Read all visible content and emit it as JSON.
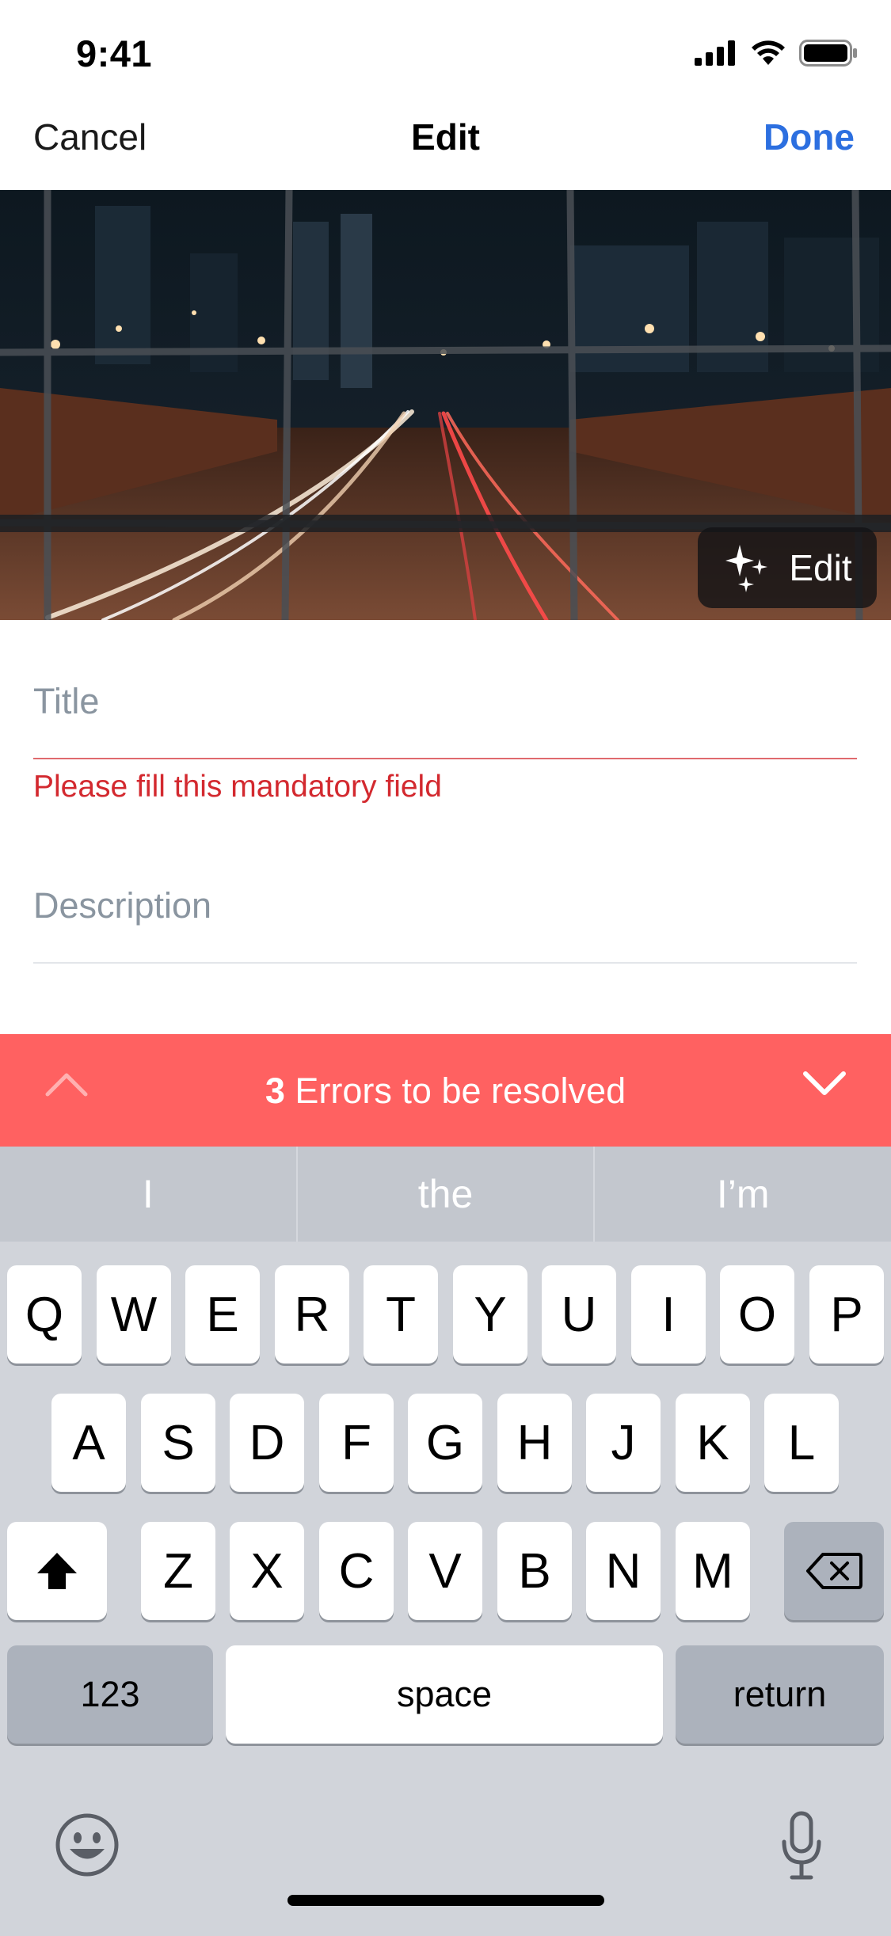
{
  "status": {
    "time": "9:41"
  },
  "nav": {
    "cancel": "Cancel",
    "title": "Edit",
    "done": "Done"
  },
  "photo": {
    "edit_label": "Edit"
  },
  "form": {
    "title_placeholder": "Title",
    "title_error": "Please fill this mandatory field",
    "description_placeholder": "Description"
  },
  "error_bar": {
    "count": "3",
    "message": "Errors to be resolved"
  },
  "keyboard": {
    "suggestions": [
      "I",
      "the",
      "I’m"
    ],
    "row1": [
      "Q",
      "W",
      "E",
      "R",
      "T",
      "Y",
      "U",
      "I",
      "O",
      "P"
    ],
    "row2": [
      "A",
      "S",
      "D",
      "F",
      "G",
      "H",
      "J",
      "K",
      "L"
    ],
    "row3": [
      "Z",
      "X",
      "C",
      "V",
      "B",
      "N",
      "M"
    ],
    "numbers_label": "123",
    "space_label": "space",
    "return_label": "return"
  },
  "colors": {
    "accent": "#2c6fe0",
    "error": "#d3292f",
    "error_bar": "#ff6161"
  }
}
